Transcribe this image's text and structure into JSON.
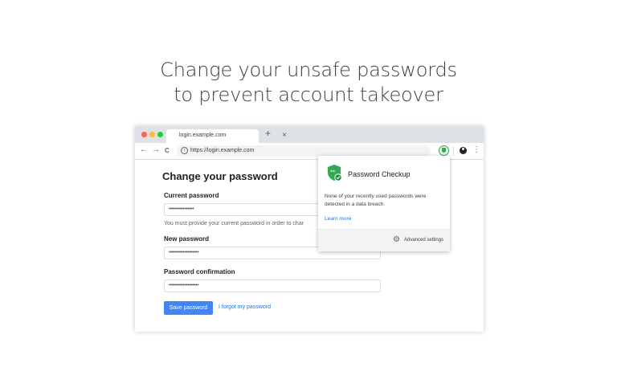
{
  "headline": {
    "line1": "Change your unsafe passwords",
    "line2": "to prevent account takeover"
  },
  "browser": {
    "window_controls": {
      "close_color": "#ff5f57",
      "minimize_color": "#febc2e",
      "zoom_color": "#28c840"
    },
    "tab": {
      "title": "login.example.com",
      "close_glyph": "×"
    },
    "new_tab_glyph": "+",
    "nav": {
      "back_glyph": "←",
      "forward_glyph": "→",
      "reload_glyph": "C"
    },
    "omnibox": {
      "url": "https://login.example.com",
      "icon": "info-icon"
    },
    "menu_glyph": "⋮"
  },
  "form": {
    "title": "Change your password",
    "current_label": "Current password",
    "current_value": "••••••••••••••••",
    "hint": "You must provide your current password in order to char",
    "new_label": "New password",
    "new_value": "•••••••••••••••••••",
    "confirm_label": "Password confirmation",
    "confirm_value": "•••••••••••••••••••",
    "save_label": "Save password",
    "forgot_label": "I forgot my password",
    "accent": "#4285f4"
  },
  "popup": {
    "title": "Password Checkup",
    "message": "None of your recently used passwords were detected in a data breach.",
    "link": "Learn more",
    "footer_label": "Advanced settings",
    "gear_glyph": "⚙",
    "shield_color": "#34a853"
  }
}
